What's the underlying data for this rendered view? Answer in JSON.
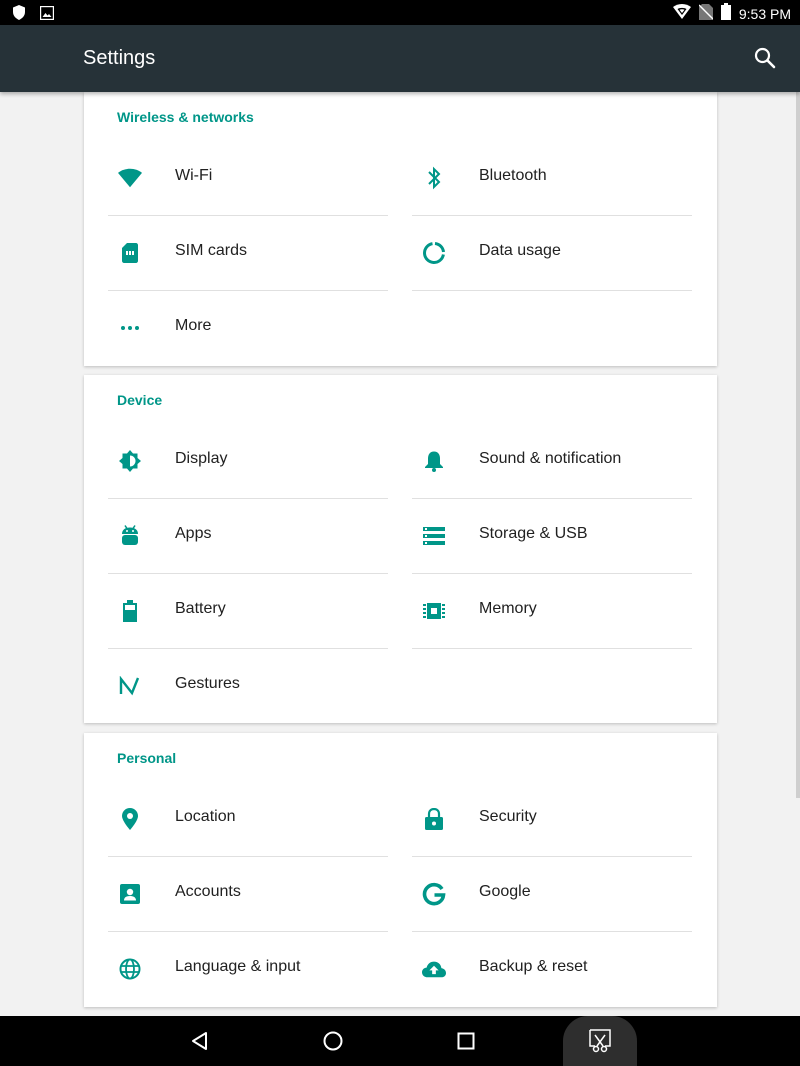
{
  "status_bar": {
    "time": "9:53 PM",
    "left_icons": [
      "shield-icon",
      "image-icon"
    ],
    "right_icons": [
      "wifi-signal-icon",
      "no-sim-icon",
      "battery-icon"
    ]
  },
  "app_bar": {
    "title": "Settings",
    "search_icon": "search-icon"
  },
  "sections": [
    {
      "title": "Wireless & networks",
      "items": [
        {
          "label": "Wi-Fi",
          "icon": "wifi-icon"
        },
        {
          "label": "Bluetooth",
          "icon": "bluetooth-icon"
        },
        {
          "label": "SIM cards",
          "icon": "sim-card-icon"
        },
        {
          "label": "Data usage",
          "icon": "data-usage-icon"
        },
        {
          "label": "More",
          "icon": "more-dots-icon"
        }
      ]
    },
    {
      "title": "Device",
      "items": [
        {
          "label": "Display",
          "icon": "brightness-icon"
        },
        {
          "label": "Sound & notification",
          "icon": "bell-icon"
        },
        {
          "label": "Apps",
          "icon": "android-icon"
        },
        {
          "label": "Storage & USB",
          "icon": "storage-icon"
        },
        {
          "label": "Battery",
          "icon": "battery-icon"
        },
        {
          "label": "Memory",
          "icon": "memory-chip-icon"
        },
        {
          "label": "Gestures",
          "icon": "gestures-icon"
        }
      ]
    },
    {
      "title": "Personal",
      "items": [
        {
          "label": "Location",
          "icon": "location-pin-icon"
        },
        {
          "label": "Security",
          "icon": "lock-icon"
        },
        {
          "label": "Accounts",
          "icon": "account-box-icon"
        },
        {
          "label": "Google",
          "icon": "google-g-icon"
        },
        {
          "label": "Language & input",
          "icon": "globe-icon"
        },
        {
          "label": "Backup & reset",
          "icon": "cloud-upload-icon"
        }
      ]
    }
  ],
  "nav_bar": {
    "buttons": [
      "back-icon",
      "home-icon",
      "recents-icon",
      "screenshot-scissors-icon"
    ]
  },
  "colors": {
    "accent": "#009688",
    "app_bar": "#263238",
    "background": "#f2f2f2",
    "card": "#ffffff",
    "divider": "#e0e0e0"
  }
}
